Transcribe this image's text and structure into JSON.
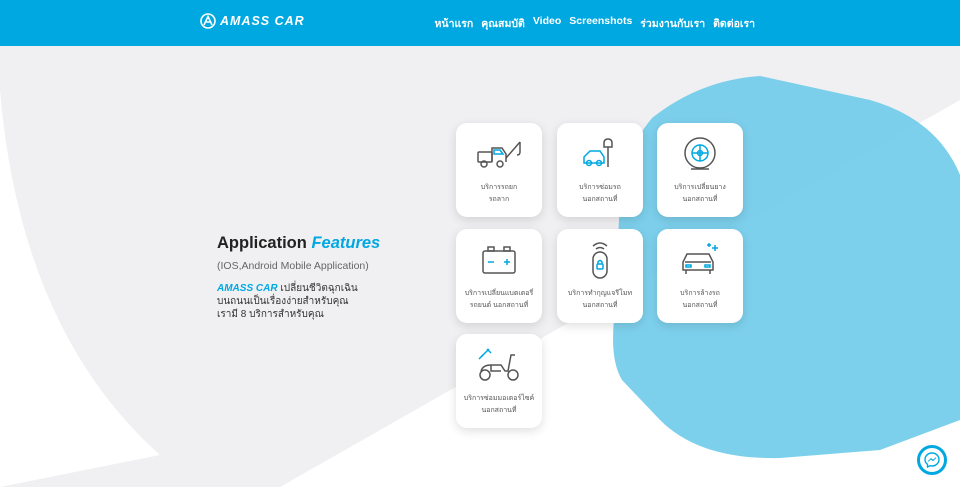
{
  "header": {
    "logo_text": "AMASS CAR",
    "nav": [
      "หน้าแรก",
      "คุณสมบัติ",
      "Video",
      "Screenshots",
      "ร่วมงานกับเรา",
      "ติดต่อเรา"
    ]
  },
  "hero": {
    "title_main": "Application",
    "title_accent": "Features",
    "subtitle": "(IOS,Android Mobile Application)",
    "brand": "AMASS CAR",
    "desc_line1_rest": " เปลี่ยนชีวิตฉุกเฉิน",
    "desc_line2": "บนถนนเป็นเรื่องง่ายสำหรับคุณ",
    "desc_line3": "เรามี 8 บริการสำหรับคุณ"
  },
  "services": [
    {
      "icon": "tow-truck-icon",
      "line1": "บริการรถยก",
      "line2": "รถลาก"
    },
    {
      "icon": "car-wrench-icon",
      "line1": "บริการซ่อมรถ",
      "line2": "นอกสถานที่"
    },
    {
      "icon": "tire-icon",
      "line1": "บริการเปลี่ยนยาง",
      "line2": "นอกสถานที่"
    },
    {
      "icon": "battery-icon",
      "line1": "บริการเปลี่ยนแบตเตอรี่",
      "line2": "รถยนต์ นอกสถานที่"
    },
    {
      "icon": "car-remote-icon",
      "line1": "บริการทำกุญแจรีโมท",
      "line2": "นอกสถานที่"
    },
    {
      "icon": "car-wash-icon",
      "line1": "บริการล้างรถ",
      "line2": "นอกสถานที่"
    },
    {
      "icon": "scooter-repair-icon",
      "line1": "บริการซ่อมมอเตอร์ไซค์",
      "line2": "นอกสถานที่"
    }
  ],
  "colors": {
    "brand": "#00a8e1",
    "hexagon": "#6fcbea",
    "background": "#f0f0f2"
  }
}
